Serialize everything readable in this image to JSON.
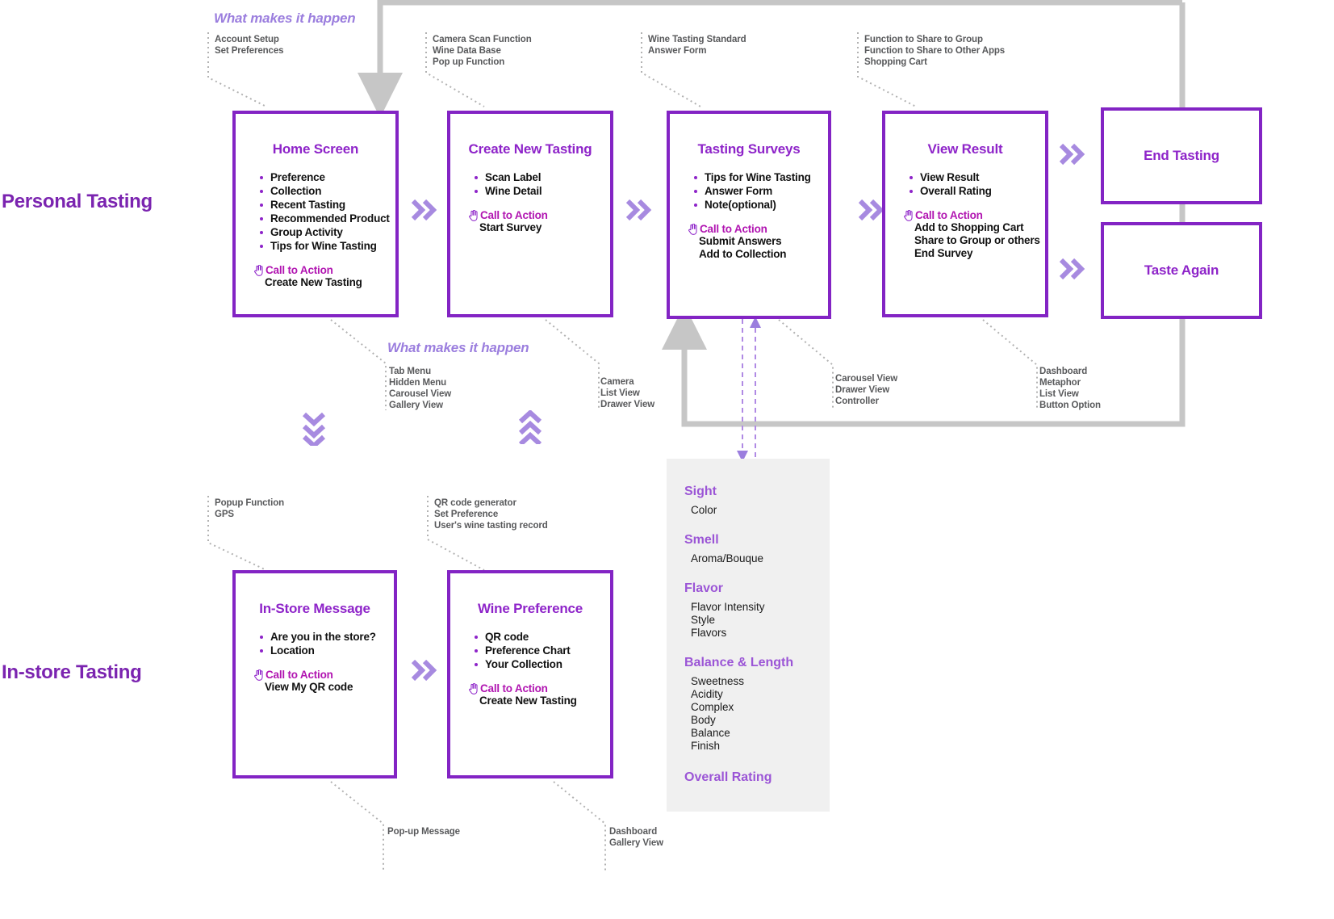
{
  "sections": [
    {
      "label": "Personal Tasting"
    },
    {
      "label": "In-store Tasting"
    }
  ],
  "callouts": {
    "what_makes_it_happen": "What makes it happen"
  },
  "top_annotations": [
    {
      "lines": [
        "Account Setup",
        "Set Preferences"
      ]
    },
    {
      "lines": [
        "Camera Scan Function",
        "Wine Data Base",
        "Pop up Function"
      ]
    },
    {
      "lines": [
        "Wine Tasting Standard",
        "Answer Form"
      ]
    },
    {
      "lines": [
        "Function to Share to Group",
        "Function to Share to Other Apps",
        "Shopping Cart"
      ]
    }
  ],
  "mid_annotations": [
    {
      "lines": [
        "Tab Menu",
        "Hidden Menu",
        "Carousel View",
        "Gallery View"
      ]
    },
    {
      "lines": [
        "Camera",
        "List View",
        "Drawer View"
      ]
    },
    {
      "lines": [
        "Carousel View",
        "Drawer View",
        "Controller"
      ]
    },
    {
      "lines": [
        "Dashboard",
        "Metaphor",
        "List View",
        "Button Option"
      ]
    }
  ],
  "lower_annotations": [
    {
      "lines": [
        "Popup Function",
        "GPS"
      ]
    },
    {
      "lines": [
        "QR code generator",
        "Set Preference",
        "User's wine tasting record"
      ]
    }
  ],
  "bottom_annotations": [
    {
      "lines": [
        "Pop-up Message"
      ]
    },
    {
      "lines": [
        "Dashboard",
        "Gallery View"
      ]
    }
  ],
  "cards": {
    "home_screen": {
      "title": "Home Screen",
      "bullets": [
        "Preference",
        "Collection",
        "Recent Tasting",
        "Recommended Product",
        "Group Activity",
        "Tips for Wine Tasting"
      ],
      "cta_label": "Call to Action",
      "cta_items": [
        "Create New Tasting"
      ]
    },
    "create_new_tasting": {
      "title": "Create New Tasting",
      "bullets": [
        "Scan Label",
        "Wine Detail"
      ],
      "cta_label": "Call to Action",
      "cta_items": [
        "Start Survey"
      ]
    },
    "tasting_surveys": {
      "title": "Tasting Surveys",
      "bullets": [
        "Tips for Wine Tasting",
        "Answer Form",
        "Note(optional)"
      ],
      "cta_label": "Call to Action",
      "cta_items": [
        "Submit Answers",
        "Add to Collection"
      ]
    },
    "view_result": {
      "title": "View Result",
      "bullets": [
        "View Result",
        "Overall Rating"
      ],
      "cta_label": "Call to Action",
      "cta_items": [
        "Add to Shopping Cart",
        "Share to Group or others",
        "End Survey"
      ]
    },
    "end_tasting": {
      "title": "End Tasting"
    },
    "taste_again": {
      "title": "Taste Again"
    },
    "in_store_message": {
      "title": "In-Store Message",
      "bullets": [
        "Are you in the store?",
        "Location"
      ],
      "cta_label": "Call to Action",
      "cta_items": [
        "View My QR code"
      ]
    },
    "wine_preference": {
      "title": "Wine Preference",
      "bullets": [
        "QR code",
        "Preference Chart",
        "Your Collection"
      ],
      "cta_label": "Call to Action",
      "cta_items": [
        "Create New Tasting"
      ]
    }
  },
  "survey_panel": {
    "groups": [
      {
        "heading": "Sight",
        "items": [
          "Color"
        ]
      },
      {
        "heading": "Smell",
        "items": [
          "Aroma/Bouque"
        ]
      },
      {
        "heading": "Flavor",
        "items": [
          "Flavor Intensity",
          "Style",
          "Flavors"
        ]
      },
      {
        "heading": "Balance & Length",
        "items": [
          "Sweetness",
          "Acidity",
          "Complex",
          "Body",
          "Balance",
          "Finish"
        ]
      },
      {
        "heading": "Overall Rating",
        "items": []
      }
    ]
  },
  "colors": {
    "primary_purple": "#8324c4",
    "title_purple": "#8e24c9",
    "cta_magenta": "#b115b1",
    "light_purple": "#a78ae0",
    "heading_purple": "#9b55d6",
    "gray_line": "#bdbdbd",
    "gray_panel": "#f0f0f0",
    "annotation_gray": "#58595b"
  }
}
